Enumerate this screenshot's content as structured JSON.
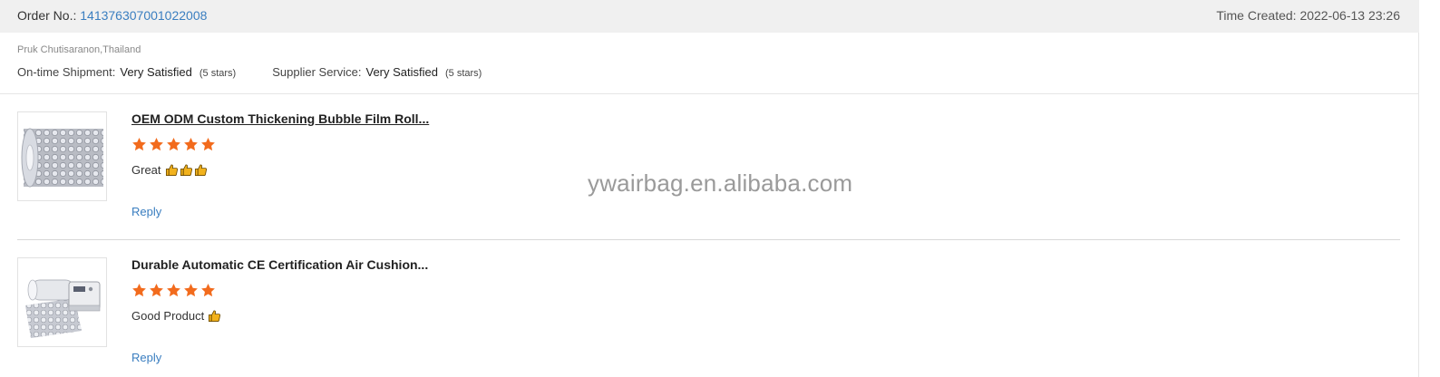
{
  "order": {
    "number_label": "Order No.:",
    "number_value": "141376307001022008",
    "time_label": "Time Created:",
    "time_value": "2022-06-13 23:26"
  },
  "buyer": {
    "name": "Pruk Chutisaranon,Thailand"
  },
  "ratings": [
    {
      "label": "On-time Shipment:",
      "value": "Very Satisfied",
      "stars_text": "(5 stars)",
      "stars": 5
    },
    {
      "label": "Supplier Service:",
      "value": "Very Satisfied",
      "stars_text": "(5 stars)",
      "stars": 5
    }
  ],
  "reviews": [
    {
      "product_title": "OEM ODM Custom Thickening Bubble Film Roll...",
      "stars": 5,
      "comment": "Great",
      "thumb_count": 3,
      "reply_label": "Reply",
      "thumb_image": "bubble-film-roll-image"
    },
    {
      "product_title": "Durable Automatic CE Certification Air Cushion...",
      "stars": 5,
      "comment": "Good Product",
      "thumb_count": 1,
      "reply_label": "Reply",
      "thumb_image": "air-cushion-machine-image"
    }
  ],
  "watermark": "ywairbag.en.alibaba.com",
  "colors": {
    "accent_link": "#3a7ec0",
    "star": "#f26b1d",
    "thumbs_up": "#f2b21d",
    "header_bg": "#f0f0f0"
  },
  "icons": {
    "star": "star-icon",
    "thumbs_up": "thumbs-up-icon"
  }
}
